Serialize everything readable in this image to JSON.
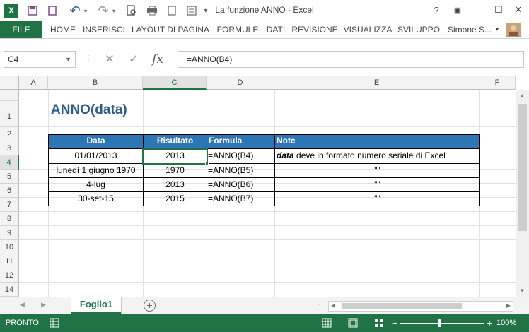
{
  "window": {
    "title": "La funzione ANNO - Excel",
    "help": "?",
    "ribbon_display": "▣",
    "minimize": "—",
    "maximize": "☐",
    "close": "✕"
  },
  "quick_access": {
    "app_icon": "X",
    "save": "💾",
    "undo": "↶",
    "redo": "↷"
  },
  "ribbon": {
    "file": "FILE",
    "tabs": [
      "HOME",
      "INSERISCI",
      "LAYOUT DI PAGINA",
      "FORMULE",
      "DATI",
      "REVISIONE",
      "VISUALIZZA",
      "SVILUPPO"
    ],
    "user": "Simone S..."
  },
  "formula_bar": {
    "name_box": "C4",
    "cancel": "✕",
    "enter": "✓",
    "fx": "fx",
    "formula": "=ANNO(B4)"
  },
  "columns": [
    "A",
    "B",
    "C",
    "D",
    "E",
    "F"
  ],
  "selected_column": "C",
  "rows": [
    "1",
    "2",
    "3",
    "4",
    "5",
    "6",
    "7",
    "8",
    "9",
    "10",
    "11",
    "12",
    "13",
    "14"
  ],
  "selected_row": "4",
  "sheet": {
    "title": "ANNO(data)",
    "table": {
      "headers": [
        "Data",
        "Risultato",
        "Formula",
        "Note"
      ],
      "rows": [
        {
          "data": "01/01/2013",
          "risultato": "2013",
          "formula": "=ANNO(B4)",
          "note_bold": "data",
          "note": " deve in formato numero seriale di Excel"
        },
        {
          "data": "lunedì 1 giugno 1970",
          "risultato": "1970",
          "formula": "=ANNO(B5)",
          "note_bold": "",
          "note": "\"\""
        },
        {
          "data": "4-lug",
          "risultato": "2013",
          "formula": "=ANNO(B6)",
          "note_bold": "",
          "note": "\"\""
        },
        {
          "data": "30-set-15",
          "risultato": "2015",
          "formula": "=ANNO(B7)",
          "note_bold": "",
          "note": "\"\""
        }
      ]
    }
  },
  "sheet_tabs": {
    "active": "Foglio1",
    "add": "+"
  },
  "status": {
    "text": "PRONTO",
    "zoom": "100%",
    "zoom_minus": "−",
    "zoom_plus": "+"
  },
  "colors": {
    "excel_green": "#217346",
    "header_blue": "#2e75b6",
    "title_blue": "#2e5b8a"
  }
}
